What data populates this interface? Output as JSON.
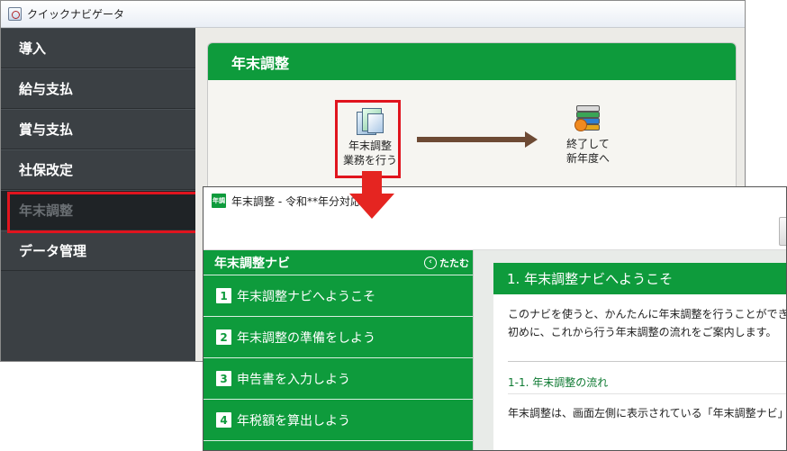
{
  "back_window": {
    "title": "クイックナビゲータ",
    "sidebar": {
      "items": [
        {
          "label": "導入"
        },
        {
          "label": "給与支払"
        },
        {
          "label": "賞与支払"
        },
        {
          "label": "社保改定"
        },
        {
          "label": "年末調整",
          "active": true
        },
        {
          "label": "データ管理"
        }
      ]
    },
    "panel": {
      "title": "年末調整",
      "start_button": {
        "line1": "年末調整",
        "line2": "業務を行う",
        "icon": "documents-icon"
      },
      "end_step": {
        "line1": "終了して",
        "line2": "新年度へ",
        "icon": "books-icon"
      }
    }
  },
  "front_window": {
    "app_icon_text": "年調",
    "title": "年末調整 - 令和**年分対応",
    "nav": {
      "title": "年末調整ナビ",
      "collapse_label": "たたむ",
      "items": [
        {
          "num": "1",
          "label": "年末調整ナビへようこそ"
        },
        {
          "num": "2",
          "label": "年末調整の準備をしよう"
        },
        {
          "num": "3",
          "label": "申告書を入力しよう"
        },
        {
          "num": "4",
          "label": "年税額を算出しよう"
        }
      ]
    },
    "content": {
      "heading": "1. 年末調整ナビへようこそ",
      "paragraph_line1": "このナビを使うと、かんたんに年末調整を行うことができます",
      "paragraph_line2": "初めに、これから行う年末調整の流れをご案内します。",
      "subheading": "1-1. 年末調整の流れ",
      "body_line": "年末調整は、画面左側に表示されている「年末調整ナビ」"
    }
  },
  "colors": {
    "accent_green": "#0e9b3c",
    "highlight_red": "#e0141e",
    "sidebar_dark": "#3b4044"
  }
}
